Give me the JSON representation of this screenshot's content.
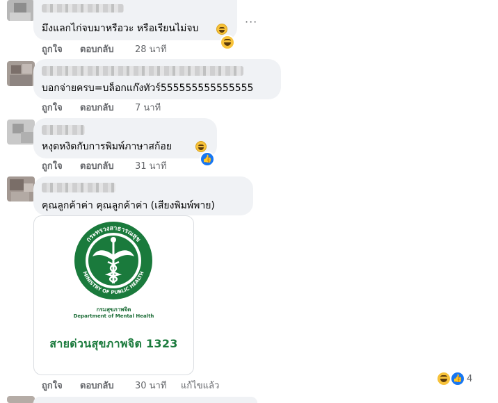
{
  "comments": [
    {
      "text": "มึงแลกไก่จบมาหรือวะ หรือเรียนไม่จบ",
      "actions": {
        "like": "ถูกใจ",
        "reply": "ตอบกลับ",
        "time": "28 นาที"
      }
    },
    {
      "text": "บอกจ่ายครบ=บล็อกแก๊งทัวร์555555555555555",
      "actions": {
        "like": "ถูกใจ",
        "reply": "ตอบกลับ",
        "time": "7 นาที"
      }
    },
    {
      "text": "หงุดหงิดกับการพิมพ์ภาษาสก้อย",
      "actions": {
        "like": "ถูกใจ",
        "reply": "ตอบกลับ",
        "time": "31 นาที"
      }
    },
    {
      "text": "คุณลูกค้าค่า คุณลูกค้าค่า (เสียงพิมพ์พาย)",
      "actions": {
        "like": "ถูกใจ",
        "reply": "ตอบกลับ",
        "time": "30 นาที",
        "edited": "แก้ไขแล้ว"
      },
      "attachment": {
        "logo_arc_top": "กระทรวงสาธารณสุข",
        "logo_arc_bottom": "MINISTRY OF PUBLIC HEALTH",
        "dept_thai": "กรมสุขภาพจิต",
        "dept_en": "Department of Mental Health",
        "hotline": "สายด่วนสุขภาพจิต 1323"
      },
      "reaction_count": "4"
    }
  ],
  "more_menu": "···",
  "colors": {
    "bubble": "#f0f2f5",
    "meta_text": "#65676b",
    "logo_green": "#1a7a3c",
    "like_blue": "#1877f2",
    "haha_yellow": "#f7c23a"
  },
  "icons": [
    "grin-emoji",
    "haha-reaction-icon",
    "like-reaction-icon",
    "more-options-icon",
    "moph-logo"
  ]
}
